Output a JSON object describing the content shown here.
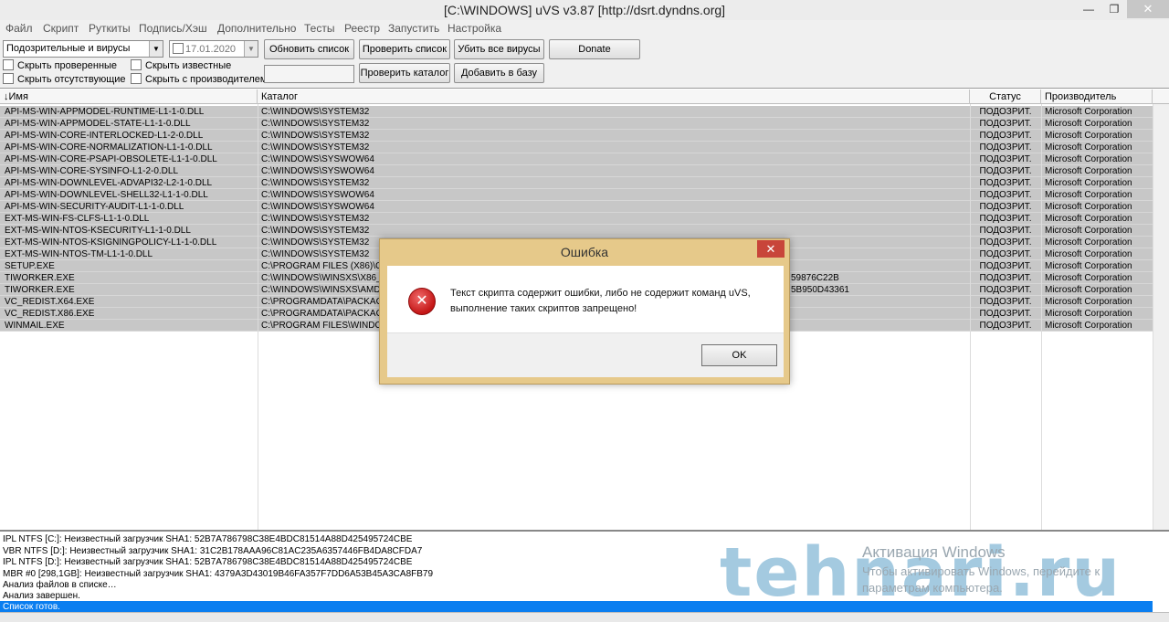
{
  "window": {
    "title": "[C:\\WINDOWS] uVS v3.87 [http://dsrt.dyndns.org]",
    "minimize": "—",
    "maximize": "❐",
    "close": "✕"
  },
  "menu": [
    "Файл",
    "Скрипт",
    "Руткиты",
    "Подпись/Хэш",
    "Дополнительно",
    "Тесты",
    "Реестр",
    "Запустить",
    "Настройка"
  ],
  "toolbar": {
    "filter_select": "Подозрительные и вирусы",
    "date_value": "17.01.2020",
    "refresh_list": "Обновить список",
    "check_list": "Проверить список",
    "kill_all_viruses": "Убить все вирусы",
    "donate": "Donate",
    "check_folder": "Проверить каталог",
    "add_to_base": "Добавить в базу",
    "hide_checked": "Скрыть проверенные",
    "hide_known": "Скрыть известные",
    "hide_missing": "Скрыть отсутствующие",
    "hide_with_vendor": "Скрыть с производителем"
  },
  "grid": {
    "columns": [
      "↓Имя",
      "Каталог",
      "Статус",
      "Производитель"
    ],
    "rows": [
      {
        "name": "API-MS-WIN-APPMODEL-RUNTIME-L1-1-0.DLL",
        "dir": "C:\\WINDOWS\\SYSTEM32",
        "extra": "",
        "status": "ПОДОЗРИТ.",
        "vendor": "Microsoft Corporation"
      },
      {
        "name": "API-MS-WIN-APPMODEL-STATE-L1-1-0.DLL",
        "dir": "C:\\WINDOWS\\SYSTEM32",
        "extra": "",
        "status": "ПОДОЗРИТ.",
        "vendor": "Microsoft Corporation"
      },
      {
        "name": "API-MS-WIN-CORE-INTERLOCKED-L1-2-0.DLL",
        "dir": "C:\\WINDOWS\\SYSTEM32",
        "extra": "",
        "status": "ПОДОЗРИТ.",
        "vendor": "Microsoft Corporation"
      },
      {
        "name": "API-MS-WIN-CORE-NORMALIZATION-L1-1-0.DLL",
        "dir": "C:\\WINDOWS\\SYSTEM32",
        "extra": "",
        "status": "ПОДОЗРИТ.",
        "vendor": "Microsoft Corporation"
      },
      {
        "name": "API-MS-WIN-CORE-PSAPI-OBSOLETE-L1-1-0.DLL",
        "dir": "C:\\WINDOWS\\SYSWOW64",
        "extra": "",
        "status": "ПОДОЗРИТ.",
        "vendor": "Microsoft Corporation"
      },
      {
        "name": "API-MS-WIN-CORE-SYSINFO-L1-2-0.DLL",
        "dir": "C:\\WINDOWS\\SYSWOW64",
        "extra": "",
        "status": "ПОДОЗРИТ.",
        "vendor": "Microsoft Corporation"
      },
      {
        "name": "API-MS-WIN-DOWNLEVEL-ADVAPI32-L2-1-0.DLL",
        "dir": "C:\\WINDOWS\\SYSTEM32",
        "extra": "",
        "status": "ПОДОЗРИТ.",
        "vendor": "Microsoft Corporation"
      },
      {
        "name": "API-MS-WIN-DOWNLEVEL-SHELL32-L1-1-0.DLL",
        "dir": "C:\\WINDOWS\\SYSWOW64",
        "extra": "",
        "status": "ПОДОЗРИТ.",
        "vendor": "Microsoft Corporation"
      },
      {
        "name": "API-MS-WIN-SECURITY-AUDIT-L1-1-0.DLL",
        "dir": "C:\\WINDOWS\\SYSWOW64",
        "extra": "",
        "status": "ПОДОЗРИТ.",
        "vendor": "Microsoft Corporation"
      },
      {
        "name": "EXT-MS-WIN-FS-CLFS-L1-1-0.DLL",
        "dir": "C:\\WINDOWS\\SYSTEM32",
        "extra": "",
        "status": "ПОДОЗРИТ.",
        "vendor": "Microsoft Corporation"
      },
      {
        "name": "EXT-MS-WIN-NTOS-KSECURITY-L1-1-0.DLL",
        "dir": "C:\\WINDOWS\\SYSTEM32",
        "extra": "",
        "status": "ПОДОЗРИТ.",
        "vendor": "Microsoft Corporation"
      },
      {
        "name": "EXT-MS-WIN-NTOS-KSIGNINGPOLICY-L1-1-0.DLL",
        "dir": "C:\\WINDOWS\\SYSTEM32",
        "extra": "",
        "status": "ПОДОЗРИТ.",
        "vendor": "Microsoft Corporation"
      },
      {
        "name": "EXT-MS-WIN-NTOS-TM-L1-1-0.DLL",
        "dir": "C:\\WINDOWS\\SYSTEM32",
        "extra": "",
        "status": "ПОДОЗРИТ.",
        "vendor": "Microsoft Corporation"
      },
      {
        "name": "SETUP.EXE",
        "dir": "C:\\PROGRAM FILES (X86)\\CO",
        "extra": "",
        "status": "ПОДОЗРИТ.",
        "vendor": "Microsoft Corporation"
      },
      {
        "name": "TIWORKER.EXE",
        "dir": "C:\\WINDOWS\\WINSXS\\X86_",
        "extra": "59876C22B",
        "status": "ПОДОЗРИТ.",
        "vendor": "Microsoft Corporation"
      },
      {
        "name": "TIWORKER.EXE",
        "dir": "C:\\WINDOWS\\WINSXS\\AMD",
        "extra": "5B950D43361",
        "status": "ПОДОЗРИТ.",
        "vendor": "Microsoft Corporation"
      },
      {
        "name": "VC_REDIST.X64.EXE",
        "dir": "C:\\PROGRAMDATA\\PACKAG",
        "extra": "",
        "status": "ПОДОЗРИТ.",
        "vendor": "Microsoft Corporation"
      },
      {
        "name": "VC_REDIST.X86.EXE",
        "dir": "C:\\PROGRAMDATA\\PACKAG",
        "extra": "",
        "status": "ПОДОЗРИТ.",
        "vendor": "Microsoft Corporation"
      },
      {
        "name": "WINMAIL.EXE",
        "dir": "C:\\PROGRAM FILES\\WINDOW",
        "extra": "",
        "status": "ПОДОЗРИТ.",
        "vendor": "Microsoft Corporation"
      }
    ]
  },
  "log": {
    "lines": [
      "IPL NTFS [C:]: Неизвестный загрузчик SHA1: 52B7A786798C38E4BDC81514A88D425495724CBE",
      "VBR NTFS [D:]: Неизвестный загрузчик SHA1: 31C2B178AAA96C81AC235A6357446FB4DA8CFDA7",
      "IPL NTFS [D:]: Неизвестный загрузчик SHA1: 52B7A786798C38E4BDC81514A88D425495724CBE",
      "MBR #0 [298,1GB]: Неизвестный загрузчик SHA1: 4379A3D43019B46FA357F7DD6A53B45A3CA8FB79",
      "Анализ файлов в списке…",
      "Анализ завершен."
    ],
    "selected_line": "Список готов."
  },
  "overlay": {
    "watermark": "tehnari.ru",
    "activation_title": "Активация Windows",
    "activation_text": "Чтобы активировать Windows, перейдите к параметрам компьютера."
  },
  "dialog": {
    "title": "Ошибка",
    "close": "✕",
    "icon": "✕",
    "message_line1": "Текст скрипта содержит ошибки, либо не содержит команд uVS,",
    "message_line2": "выполнение таких скриптов запрещено!",
    "ok": "OK"
  }
}
